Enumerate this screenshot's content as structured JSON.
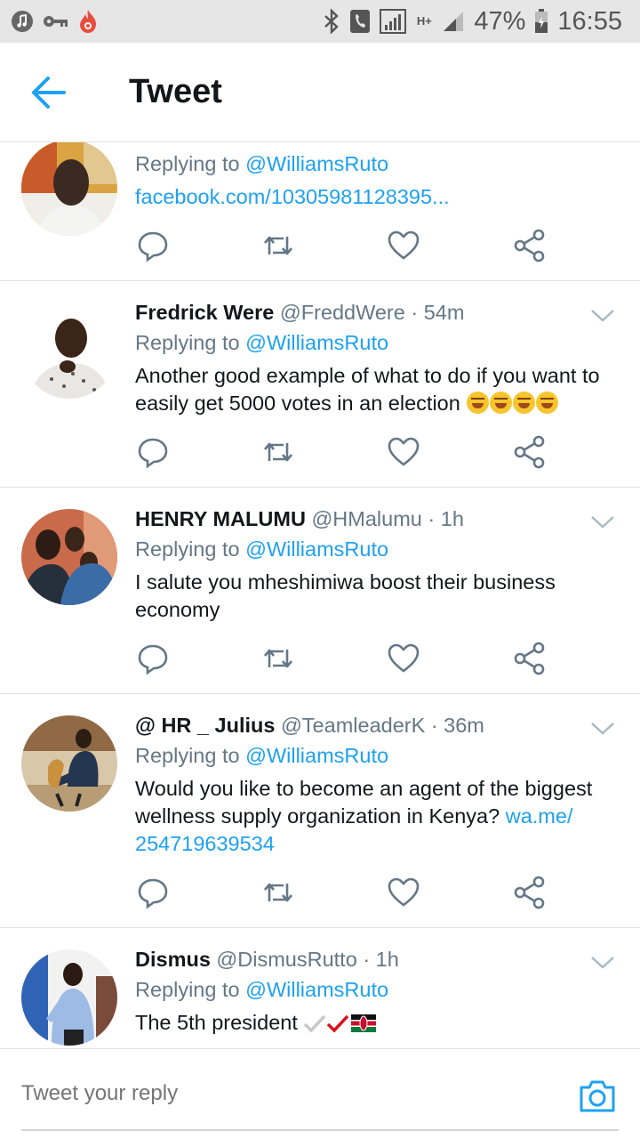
{
  "statusbar": {
    "battery": "47%",
    "time": "16:55",
    "network": "H+"
  },
  "header": {
    "title": "Tweet"
  },
  "tweets": [
    {
      "replying_prefix": "Replying to",
      "replying_handle": "@WilliamsRuto",
      "link": "facebook.com/10305981128395..."
    },
    {
      "name": "Fredrick Were",
      "handle": "@FreddWere",
      "time": "· 54m",
      "replying_prefix": "Replying to",
      "replying_handle": "@WilliamsRuto",
      "text_1": "Another good example of what to do if you want to",
      "text_2": "easily get 5000 votes in an election"
    },
    {
      "name": "HENRY MALUMU",
      "handle": "@HMalumu",
      "time": "· 1h",
      "replying_prefix": "Replying to",
      "replying_handle": "@WilliamsRuto",
      "text_1": "I salute you mheshimiwa boost their business",
      "text_2": "economy"
    },
    {
      "name": "@ HR _ Julius",
      "handle": "@TeamleaderK",
      "time": "· 36m",
      "replying_prefix": "Replying to",
      "replying_handle": "@WilliamsRuto",
      "text_1": "Would you like to become an agent of the biggest",
      "text_2": "wellness supply organization in Kenya?",
      "link_1": "wa.me/",
      "link_2": "254719639534"
    },
    {
      "name": "Dismus",
      "handle": "@DismusRutto",
      "time": "· 1h",
      "replying_prefix": "Replying to",
      "replying_handle": "@WilliamsRuto",
      "text_1": "The 5th president"
    }
  ],
  "reply": {
    "placeholder": "Tweet your reply"
  },
  "colors": {
    "accent": "#1da1f2",
    "text": "#14171a",
    "secondary": "#657786",
    "divider": "#dfe3e6"
  },
  "icons": [
    "music-icon",
    "key-icon",
    "flame-icon",
    "bluetooth-icon",
    "phone-icon",
    "signal-icon",
    "battery-icon",
    "back-arrow-icon",
    "reply-icon",
    "retweet-icon",
    "like-icon",
    "share-icon",
    "chevron-down-icon",
    "camera-icon"
  ]
}
